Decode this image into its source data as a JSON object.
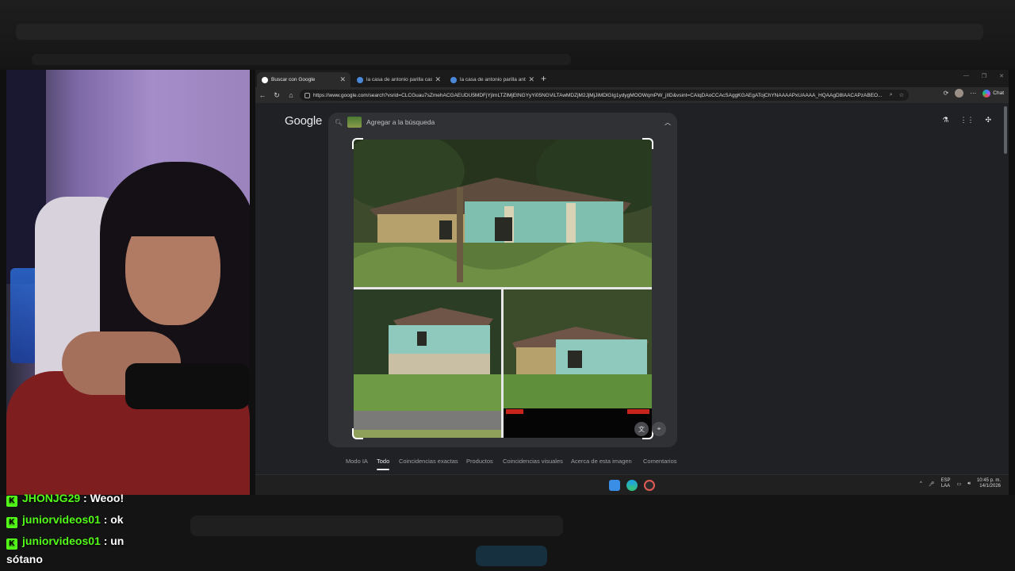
{
  "browser": {
    "tabs": [
      {
        "label": "Buscar con Google",
        "icon": "google-icon",
        "active": true
      },
      {
        "label": "la casa de antonio parilla castillo",
        "icon": "page-icon",
        "active": false
      },
      {
        "label": "la casa de antonio parilla antes de",
        "icon": "page-icon",
        "active": false
      }
    ],
    "url": "https://www.google.com/search?vsrid=CLCGuau7sZmehACGAEUDU5MDFjYjImLTZlMjEtNGYyYi05NGViLTAwMDZjM2JjMjJiMDlGIg1ydygMOOWqmPW_jIID&vsint=CAIqDAoCCAcSAggKGAEgATojChYNAAAAPxUAAAA_HQAAgD8lAACAPzABEO...",
    "chat_label": "Chat"
  },
  "google": {
    "logo": "Google",
    "search_placeholder": "Agregar a la búsqueda",
    "filters": [
      {
        "label": "Modo IA",
        "active": false
      },
      {
        "label": "Todo",
        "active": true
      },
      {
        "label": "Coincidencias exactas",
        "active": false
      },
      {
        "label": "Productos",
        "active": false
      },
      {
        "label": "Coincidencias visuales",
        "active": false
      },
      {
        "label": "Acerca de esta imagen",
        "active": false
      },
      {
        "label": "Comentarios",
        "active": false
      }
    ]
  },
  "taskbar": {
    "lang_top": "ESP",
    "lang_bottom": "LAA",
    "time": "10:45 p. m.",
    "date": "14/1/2026"
  },
  "chat": [
    {
      "user": "JHONJG29",
      "message": ": Weoo!"
    },
    {
      "user": "juniorvideos01",
      "message": ": ok"
    },
    {
      "user": "juniorvideos01",
      "message": ": un"
    },
    {
      "user": "",
      "message": "sótano"
    }
  ],
  "colors": {
    "kick_green": "#53fc18",
    "google_dark": "#202124",
    "search_panel": "#303134",
    "shirt_red": "#7e1e1f"
  }
}
